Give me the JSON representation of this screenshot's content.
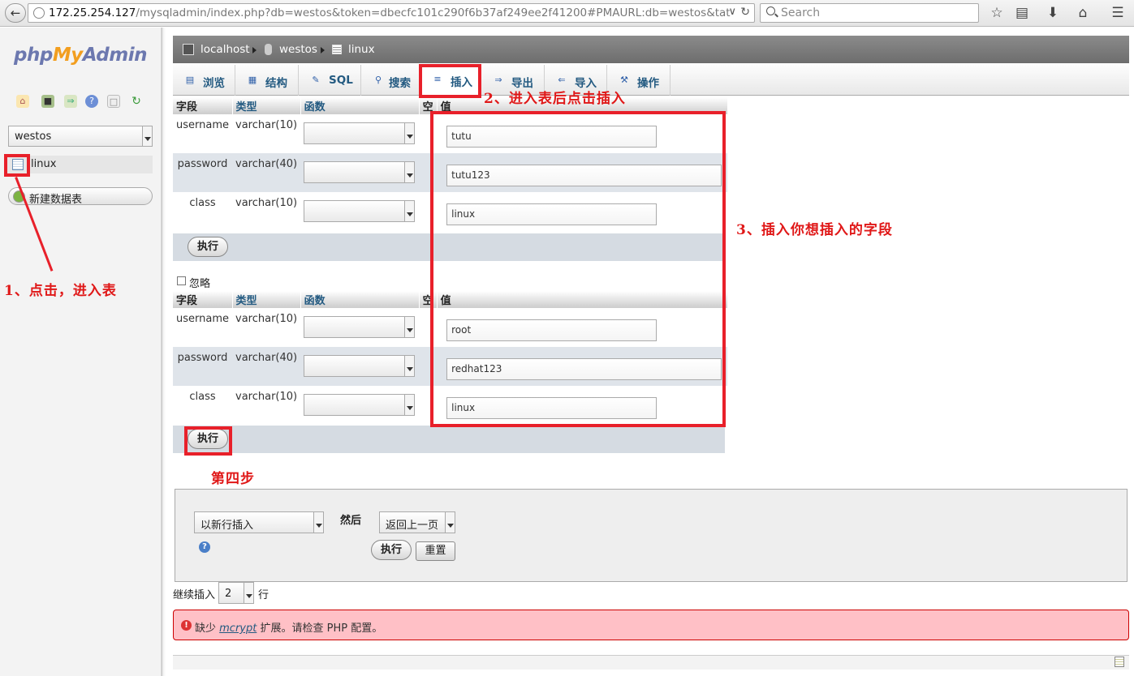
{
  "browser": {
    "url_host": "172.25.254.127",
    "url_rest": "/mysqladmin/index.php?db=westos&token=dbecfc101c290f6b37af249ee2f41200#PMAURL:db=westos&tat",
    "search_placeholder": "Search"
  },
  "sidebar": {
    "logo": {
      "php": "php",
      "my": "My",
      "admin": "Admin"
    },
    "db_selected": "westos",
    "tables": [
      "linux"
    ],
    "new_table": "新建数据表"
  },
  "breadcrumb": [
    "localhost",
    "westos",
    "linux"
  ],
  "tabs": [
    {
      "label": "浏览",
      "icon": "browse-icon"
    },
    {
      "label": "结构",
      "icon": "structure-icon"
    },
    {
      "label": "SQL",
      "icon": "sql-icon"
    },
    {
      "label": "搜索",
      "icon": "search-icon"
    },
    {
      "label": "插入",
      "icon": "insert-icon",
      "active": true
    },
    {
      "label": "导出",
      "icon": "export-icon"
    },
    {
      "label": "导入",
      "icon": "import-icon"
    },
    {
      "label": "操作",
      "icon": "operations-icon"
    }
  ],
  "insert": {
    "headers": {
      "field": "字段",
      "type": "类型",
      "function": "函数",
      "null": "空",
      "value": "值"
    },
    "set1": [
      {
        "field": "username",
        "type": "varchar(10)",
        "value": "tutu"
      },
      {
        "field": "password",
        "type": "varchar(40)",
        "value": "tutu123"
      },
      {
        "field": "class",
        "type": "varchar(10)",
        "value": "linux"
      }
    ],
    "set2": [
      {
        "field": "username",
        "type": "varchar(10)",
        "value": "root"
      },
      {
        "field": "password",
        "type": "varchar(40)",
        "value": "redhat123"
      },
      {
        "field": "class",
        "type": "varchar(10)",
        "value": "linux"
      }
    ],
    "go": "执行",
    "ignore": "忽略"
  },
  "bottom": {
    "insert_mode": "以新行插入",
    "then": "然后",
    "after": "返回上一页",
    "go": "执行",
    "reset": "重置",
    "continue_label": "继续插入",
    "continue_count": "2",
    "rows_label": "行"
  },
  "error": {
    "pre": "缺少 ",
    "ext": "mcrypt",
    "post": " 扩展。请检查 PHP 配置。"
  },
  "annotations": {
    "step1": "1、点击，进入表",
    "step2": "2、进入表后点击插入",
    "step3": "3、插入你想插入的字段",
    "step4": "第四步"
  }
}
